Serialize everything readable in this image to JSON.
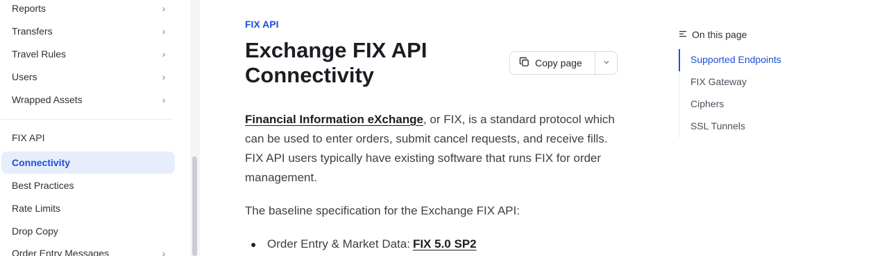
{
  "sidebar": {
    "items": [
      {
        "label": "Reports",
        "has_children": true
      },
      {
        "label": "Transfers",
        "has_children": true
      },
      {
        "label": "Travel Rules",
        "has_children": true
      },
      {
        "label": "Users",
        "has_children": true
      },
      {
        "label": "Wrapped Assets",
        "has_children": true
      }
    ],
    "section_label": "FIX API",
    "section_items": [
      {
        "label": "Connectivity",
        "active": true
      },
      {
        "label": "Best Practices"
      },
      {
        "label": "Rate Limits"
      },
      {
        "label": "Drop Copy"
      },
      {
        "label": "Order Entry Messages",
        "has_children": true
      }
    ]
  },
  "main": {
    "breadcrumb": "FIX API",
    "title": "Exchange FIX API Connectivity",
    "copy_label": "Copy page",
    "para1_link": "Financial Information eXchange",
    "para1_text": ", or FIX, is a standard protocol which can be used to enter orders, submit cancel requests, and receive fills. FIX API users typically have existing software that runs FIX for order management.",
    "para2": "The baseline specification for the Exchange FIX API:",
    "bullet_text": "Order Entry & Market Data:",
    "bullet_link": "FIX 5.0 SP2"
  },
  "toc": {
    "heading": "On this page",
    "items": [
      "Supported Endpoints",
      "FIX Gateway",
      "Ciphers",
      "SSL Tunnels"
    ],
    "active_index": 0
  },
  "colors": {
    "accent": "#1a4fd6",
    "active_bg": "#e6edfc"
  }
}
